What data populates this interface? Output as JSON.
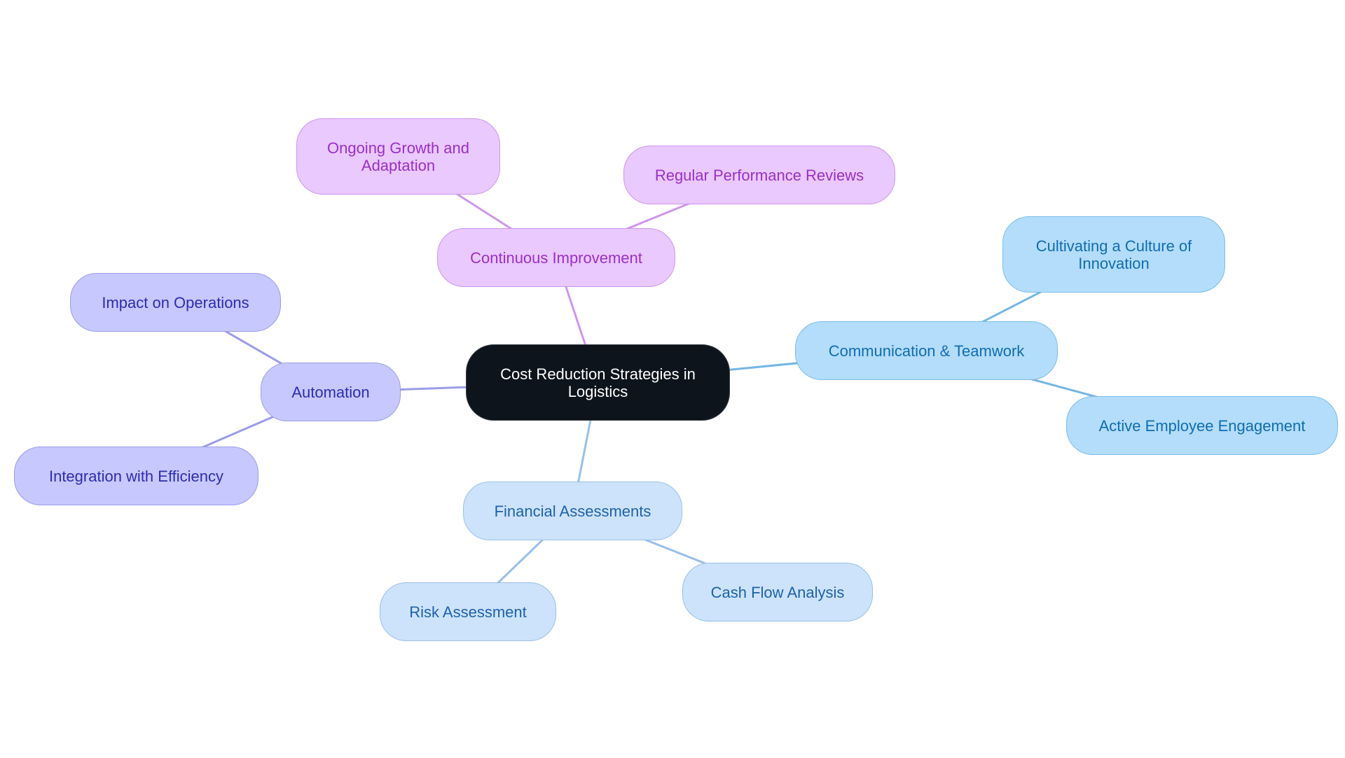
{
  "diagram": {
    "type": "mind-map",
    "root": {
      "id": "root",
      "label": "Cost Reduction Strategies in Logistics",
      "line1": "Cost Reduction Strategies in",
      "line2": "Logistics"
    },
    "branches": [
      {
        "id": "continuous-improvement",
        "label": "Continuous Improvement",
        "color": "#cf95ef",
        "children": [
          {
            "id": "ongoing-growth",
            "label": "Ongoing Growth and Adaptation",
            "line1": "Ongoing Growth and",
            "line2": "Adaptation"
          },
          {
            "id": "regular-performance",
            "label": "Regular Performance Reviews"
          }
        ]
      },
      {
        "id": "communication-teamwork",
        "label": "Communication & Teamwork",
        "color": "#74b6e3",
        "children": [
          {
            "id": "cultivating-culture",
            "label": "Cultivating a Culture of Innovation",
            "line1": "Cultivating a Culture of",
            "line2": "Innovation"
          },
          {
            "id": "active-engagement",
            "label": "Active Employee Engagement"
          }
        ]
      },
      {
        "id": "automation",
        "label": "Automation",
        "color": "#9b9ce8",
        "children": [
          {
            "id": "impact-operations",
            "label": "Impact on Operations"
          },
          {
            "id": "integration-efficiency",
            "label": "Integration with Efficiency"
          }
        ]
      },
      {
        "id": "financial-assessments",
        "label": "Financial Assessments",
        "color": "#98c0ea",
        "children": [
          {
            "id": "risk-assessment",
            "label": "Risk Assessment"
          },
          {
            "id": "cash-flow",
            "label": "Cash Flow Analysis"
          }
        ]
      }
    ],
    "edges": [
      {
        "from": "root",
        "to": "continuous-improvement",
        "color": "#cf95ef"
      },
      {
        "from": "continuous-improvement",
        "to": "ongoing-growth",
        "color": "#cf95ef"
      },
      {
        "from": "continuous-improvement",
        "to": "regular-performance",
        "color": "#cf95ef"
      },
      {
        "from": "root",
        "to": "communication-teamwork",
        "color": "#74b6e3"
      },
      {
        "from": "communication-teamwork",
        "to": "cultivating-culture",
        "color": "#74b6e3"
      },
      {
        "from": "communication-teamwork",
        "to": "active-engagement",
        "color": "#74b6e3"
      },
      {
        "from": "root",
        "to": "automation",
        "color": "#9b9ce8"
      },
      {
        "from": "automation",
        "to": "impact-operations",
        "color": "#9b9ce8"
      },
      {
        "from": "automation",
        "to": "integration-efficiency",
        "color": "#9b9ce8"
      },
      {
        "from": "root",
        "to": "financial-assessments",
        "color": "#98c0ea"
      },
      {
        "from": "financial-assessments",
        "to": "risk-assessment",
        "color": "#98c0ea"
      },
      {
        "from": "financial-assessments",
        "to": "cash-flow",
        "color": "#98c0ea"
      }
    ]
  }
}
